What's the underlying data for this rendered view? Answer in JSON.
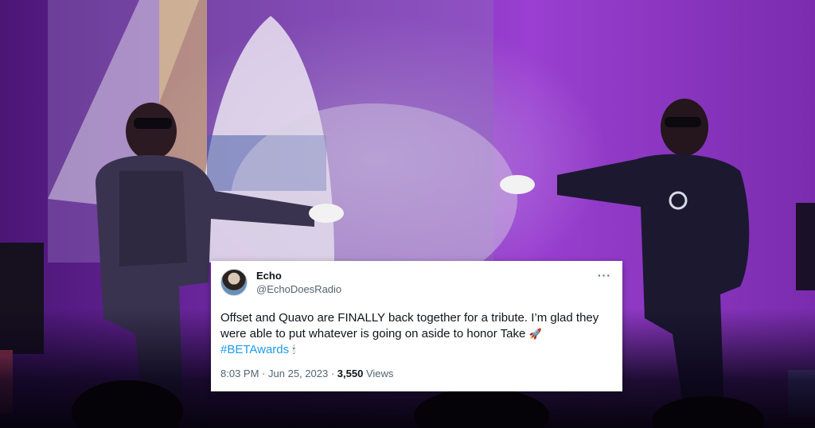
{
  "tweet": {
    "display_name": "Echo",
    "handle": "@EchoDoesRadio",
    "more_icon": "more-horizontal-icon",
    "body_text": "Offset and Quavo are FINALLY back together for a tribute. I’m glad they were able to put whatever is going on aside to honor Take",
    "emoji_rocket": "🚀",
    "hashtag": "#BETAwards",
    "emoji_candle": "🕯",
    "time": "8:03 PM",
    "separator": "·",
    "date": "Jun 25, 2023",
    "views_count": "3,550",
    "views_label": "Views"
  }
}
